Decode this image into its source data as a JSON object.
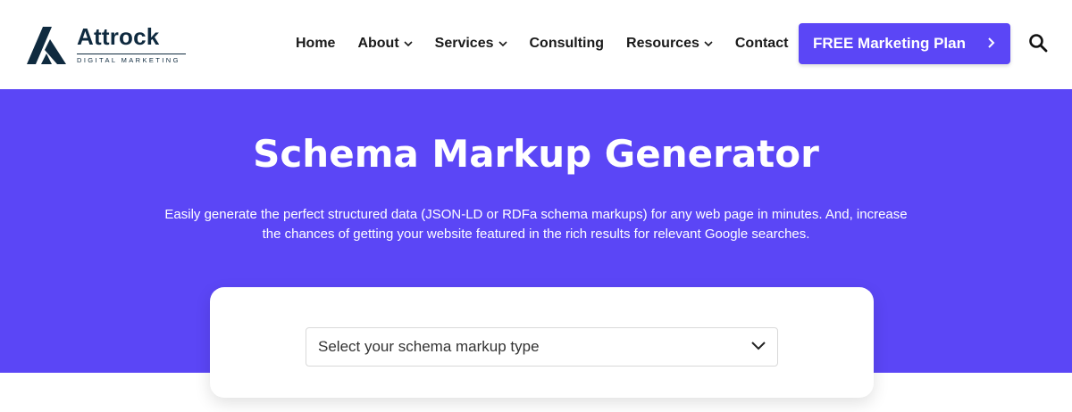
{
  "logo": {
    "brand": "Attrock",
    "tagline": "DIGITAL MARKETING"
  },
  "nav": {
    "items": [
      {
        "label": "Home",
        "has_dropdown": false
      },
      {
        "label": "About",
        "has_dropdown": true
      },
      {
        "label": "Services",
        "has_dropdown": true
      },
      {
        "label": "Consulting",
        "has_dropdown": false
      },
      {
        "label": "Resources",
        "has_dropdown": true
      },
      {
        "label": "Contact",
        "has_dropdown": false
      }
    ]
  },
  "cta": {
    "label": "FREE Marketing Plan",
    "icon": "chevron-right-icon"
  },
  "search": {
    "icon": "search-icon"
  },
  "hero": {
    "title": "Schema Markup Generator",
    "description_line1": "Easily generate the perfect structured data (JSON-LD or RDFa schema markups) for any web page in minutes. And, increase",
    "description_line2": "the chances of getting your website featured in the rich results for relevant Google searches."
  },
  "schema_select": {
    "placeholder": "Select your schema markup type",
    "icon": "chevron-down-icon"
  },
  "colors": {
    "accent": "#5b46f6",
    "brand_dark": "#0f2a3f",
    "white": "#ffffff"
  }
}
